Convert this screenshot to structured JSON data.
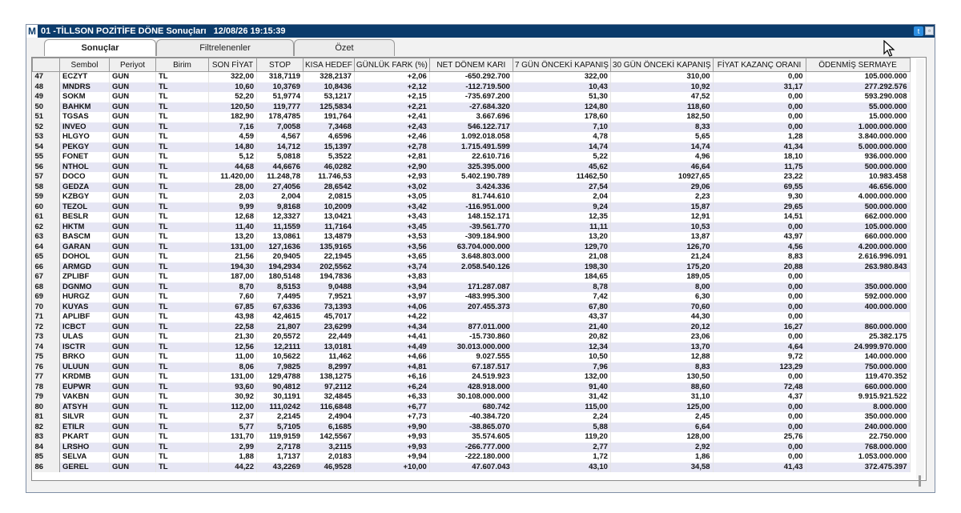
{
  "window": {
    "app_letter": "M",
    "title": "01 -TİLLSON POZİTİFE DÖNE Sonuçları",
    "datetime": "12/08/26 19:15:39",
    "twitter_icon": "twitter-icon",
    "restore_icon": "restore-icon"
  },
  "tabs": [
    {
      "label": "Sonuçlar",
      "active": true
    },
    {
      "label": "Filtrelenenler",
      "active": false
    },
    {
      "label": "Özet",
      "active": false
    }
  ],
  "table": {
    "columns": [
      "",
      "Sembol",
      "Periyot",
      "Birim",
      "SON FİYAT",
      "STOP",
      "KISA HEDEF",
      "GÜNLÜK FARK (%)",
      "NET DÖNEM KARI",
      "7 GÜN ÖNCEKİ KAPANIŞ",
      "30 GÜN ÖNCEKİ KAPANIŞ",
      "FİYAT KAZANÇ ORANI",
      "ÖDENMİŞ SERMAYE"
    ],
    "rows": [
      [
        "47",
        "ECZYT",
        "GUN",
        "TL",
        "322,00",
        "318,7119",
        "328,2137",
        "+2,06",
        "-650.292.700",
        "322,00",
        "310,00",
        "0,00",
        "105.000.000"
      ],
      [
        "48",
        "MNDRS",
        "GUN",
        "TL",
        "10,60",
        "10,3769",
        "10,8436",
        "+2,12",
        "-112.719.500",
        "10,43",
        "10,92",
        "31,17",
        "277.292.576"
      ],
      [
        "49",
        "SOKM",
        "GUN",
        "TL",
        "52,20",
        "51,9774",
        "53,1217",
        "+2,15",
        "-735.697.200",
        "51,30",
        "47,52",
        "0,00",
        "593.290.008"
      ],
      [
        "50",
        "BAHKM",
        "GUN",
        "TL",
        "120,50",
        "119,777",
        "125,5834",
        "+2,21",
        "-27.684.320",
        "124,80",
        "118,60",
        "0,00",
        "55.000.000"
      ],
      [
        "51",
        "TGSAS",
        "GUN",
        "TL",
        "182,90",
        "178,4785",
        "191,764",
        "+2,41",
        "3.667.696",
        "178,60",
        "182,50",
        "0,00",
        "15.000.000"
      ],
      [
        "52",
        "INVEO",
        "GUN",
        "TL",
        "7,16",
        "7,0058",
        "7,3468",
        "+2,43",
        "546.122.717",
        "7,10",
        "8,33",
        "0,00",
        "1.000.000.000"
      ],
      [
        "53",
        "HLGYO",
        "GUN",
        "TL",
        "4,59",
        "4,567",
        "4,6596",
        "+2,46",
        "1.092.018.058",
        "4,78",
        "5,65",
        "1,28",
        "3.840.000.000"
      ],
      [
        "54",
        "PEKGY",
        "GUN",
        "TL",
        "14,80",
        "14,712",
        "15,1397",
        "+2,78",
        "1.715.491.599",
        "14,74",
        "14,74",
        "41,34",
        "5.000.000.000"
      ],
      [
        "55",
        "FONET",
        "GUN",
        "TL",
        "5,12",
        "5,0818",
        "5,3522",
        "+2,81",
        "22.610.716",
        "5,22",
        "4,96",
        "18,10",
        "936.000.000"
      ],
      [
        "56",
        "NTHOL",
        "GUN",
        "TL",
        "44,68",
        "44,6676",
        "46,0282",
        "+2,90",
        "325.395.000",
        "45,62",
        "46,64",
        "11,75",
        "500.000.000"
      ],
      [
        "57",
        "DOCO",
        "GUN",
        "TL",
        "11.420,00",
        "11.248,78",
        "11.746,53",
        "+2,93",
        "5.402.190.789",
        "11462,50",
        "10927,65",
        "23,22",
        "10.983.458"
      ],
      [
        "58",
        "GEDZA",
        "GUN",
        "TL",
        "28,00",
        "27,4056",
        "28,6542",
        "+3,02",
        "3.424.336",
        "27,54",
        "29,06",
        "69,55",
        "46.656.000"
      ],
      [
        "59",
        "KZBGY",
        "GUN",
        "TL",
        "2,03",
        "2,004",
        "2,0815",
        "+3,05",
        "81.744.610",
        "2,04",
        "2,23",
        "9,30",
        "4.000.000.000"
      ],
      [
        "60",
        "TEZOL",
        "GUN",
        "TL",
        "9,99",
        "9,8168",
        "10,2009",
        "+3,42",
        "-116.951.000",
        "9,24",
        "15,87",
        "29,65",
        "500.000.000"
      ],
      [
        "61",
        "BESLR",
        "GUN",
        "TL",
        "12,68",
        "12,3327",
        "13,0421",
        "+3,43",
        "148.152.171",
        "12,35",
        "12,91",
        "14,51",
        "662.000.000"
      ],
      [
        "62",
        "HKTM",
        "GUN",
        "TL",
        "11,40",
        "11,1559",
        "11,7164",
        "+3,45",
        "-39.561.770",
        "11,11",
        "10,53",
        "0,00",
        "105.000.000"
      ],
      [
        "63",
        "BASCM",
        "GUN",
        "TL",
        "13,20",
        "13,0861",
        "13,4879",
        "+3,53",
        "-309.184.900",
        "13,20",
        "13,87",
        "43,97",
        "660.000.000"
      ],
      [
        "64",
        "GARAN",
        "GUN",
        "TL",
        "131,00",
        "127,1636",
        "135,9165",
        "+3,56",
        "63.704.000.000",
        "129,70",
        "126,70",
        "4,56",
        "4.200.000.000"
      ],
      [
        "65",
        "DOHOL",
        "GUN",
        "TL",
        "21,56",
        "20,9405",
        "22,1945",
        "+3,65",
        "3.648.803.000",
        "21,08",
        "21,24",
        "8,83",
        "2.616.996.091"
      ],
      [
        "66",
        "ARMGD",
        "GUN",
        "TL",
        "194,30",
        "194,2934",
        "202,5562",
        "+3,74",
        "2.058.540.126",
        "198,30",
        "175,20",
        "20,88",
        "263.980.843"
      ],
      [
        "67",
        "ZPLIBF",
        "GUN",
        "TL",
        "187,00",
        "180,5148",
        "194,7836",
        "+3,83",
        "",
        "184,65",
        "189,05",
        "0,00",
        ""
      ],
      [
        "68",
        "DGNMO",
        "GUN",
        "TL",
        "8,70",
        "8,5153",
        "9,0488",
        "+3,94",
        "171.287.087",
        "8,78",
        "8,00",
        "0,00",
        "350.000.000"
      ],
      [
        "69",
        "HURGZ",
        "GUN",
        "TL",
        "7,60",
        "7,4495",
        "7,9521",
        "+3,97",
        "-483.995.300",
        "7,42",
        "6,30",
        "0,00",
        "592.000.000"
      ],
      [
        "70",
        "KUYAS",
        "GUN",
        "TL",
        "67,85",
        "67,6336",
        "73,1393",
        "+4,06",
        "207.455.373",
        "67,80",
        "70,60",
        "0,00",
        "400.000.000"
      ],
      [
        "71",
        "APLIBF",
        "GUN",
        "TL",
        "43,98",
        "42,4615",
        "45,7017",
        "+4,22",
        "",
        "43,37",
        "44,30",
        "0,00",
        ""
      ],
      [
        "72",
        "ICBCT",
        "GUN",
        "TL",
        "22,58",
        "21,807",
        "23,6299",
        "+4,34",
        "877.011.000",
        "21,40",
        "20,12",
        "16,27",
        "860.000.000"
      ],
      [
        "73",
        "ULAS",
        "GUN",
        "TL",
        "21,30",
        "20,5572",
        "22,449",
        "+4,41",
        "-15.730.860",
        "20,82",
        "23,06",
        "0,00",
        "25.382.175"
      ],
      [
        "74",
        "ISCTR",
        "GUN",
        "TL",
        "12,56",
        "12,2111",
        "13,0181",
        "+4,49",
        "30.013.000.000",
        "12,34",
        "13,70",
        "4,64",
        "24.999.970.000"
      ],
      [
        "75",
        "BRKO",
        "GUN",
        "TL",
        "11,00",
        "10,5622",
        "11,462",
        "+4,66",
        "9.027.555",
        "10,50",
        "12,88",
        "9,72",
        "140.000.000"
      ],
      [
        "76",
        "ULUUN",
        "GUN",
        "TL",
        "8,06",
        "7,9825",
        "8,2997",
        "+4,81",
        "67.187.517",
        "7,96",
        "8,83",
        "123,29",
        "750.000.000"
      ],
      [
        "77",
        "KRDMB",
        "GUN",
        "TL",
        "131,00",
        "129,4788",
        "138,1275",
        "+6,16",
        "24.519.923",
        "132,00",
        "130,50",
        "0,00",
        "119.470.352"
      ],
      [
        "78",
        "EUPWR",
        "GUN",
        "TL",
        "93,60",
        "90,4812",
        "97,2112",
        "+6,24",
        "428.918.000",
        "91,40",
        "88,60",
        "72,48",
        "660.000.000"
      ],
      [
        "79",
        "VAKBN",
        "GUN",
        "TL",
        "30,92",
        "30,1191",
        "32,4845",
        "+6,33",
        "30.108.000.000",
        "31,42",
        "31,10",
        "4,37",
        "9.915.921.522"
      ],
      [
        "80",
        "ATSYH",
        "GUN",
        "TL",
        "112,00",
        "111,0242",
        "116,6848",
        "+6,77",
        "680.742",
        "115,00",
        "125,00",
        "0,00",
        "8.000.000"
      ],
      [
        "81",
        "SILVR",
        "GUN",
        "TL",
        "2,37",
        "2,2145",
        "2,4904",
        "+7,73",
        "-40.384.720",
        "2,24",
        "2,45",
        "0,00",
        "350.000.000"
      ],
      [
        "82",
        "ETILR",
        "GUN",
        "TL",
        "5,77",
        "5,7105",
        "6,1685",
        "+9,90",
        "-38.865.070",
        "5,88",
        "6,64",
        "0,00",
        "240.000.000"
      ],
      [
        "83",
        "PKART",
        "GUN",
        "TL",
        "131,70",
        "119,9159",
        "142,5567",
        "+9,93",
        "35.574.605",
        "119,20",
        "128,00",
        "25,76",
        "22.750.000"
      ],
      [
        "84",
        "LRSHO",
        "GUN",
        "TL",
        "2,99",
        "2,7178",
        "3,2115",
        "+9,93",
        "-266.777.000",
        "2,77",
        "2,92",
        "0,00",
        "768.000.000"
      ],
      [
        "85",
        "SELVA",
        "GUN",
        "TL",
        "1,88",
        "1,7137",
        "2,0183",
        "+9,94",
        "-222.180.000",
        "1,72",
        "1,86",
        "0,00",
        "1.053.000.000"
      ],
      [
        "86",
        "GEREL",
        "GUN",
        "TL",
        "44,22",
        "43,2269",
        "46,9528",
        "+10,00",
        "47.607.043",
        "43,10",
        "34,58",
        "41,43",
        "372.475.397"
      ]
    ]
  },
  "cursor": {
    "icon": "mouse-cursor-icon"
  }
}
